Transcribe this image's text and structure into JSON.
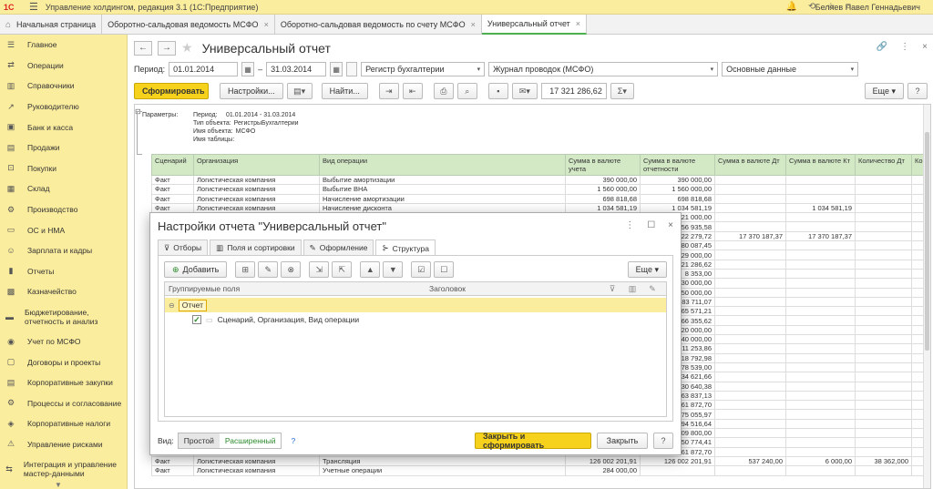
{
  "app": {
    "logo": "1С",
    "title": "Управление холдингом, редакция 3.1  (1С:Предприятие)",
    "user": "Беляев Павел Геннадьевич"
  },
  "tabs": [
    {
      "label": "Начальная страница"
    },
    {
      "label": "Оборотно-сальдовая ведомость МСФО"
    },
    {
      "label": "Оборотно-сальдовая ведомость по счету МСФО"
    },
    {
      "label": "Универсальный отчет"
    }
  ],
  "sidebar": {
    "items": [
      {
        "label": "Главное",
        "icon": "☰"
      },
      {
        "label": "Операции",
        "icon": "⇄"
      },
      {
        "label": "Справочники",
        "icon": "▥"
      },
      {
        "label": "Руководителю",
        "icon": "↗"
      },
      {
        "label": "Банк и касса",
        "icon": "▣"
      },
      {
        "label": "Продажи",
        "icon": "▤"
      },
      {
        "label": "Покупки",
        "icon": "⊡"
      },
      {
        "label": "Склад",
        "icon": "▦"
      },
      {
        "label": "Производство",
        "icon": "⚙"
      },
      {
        "label": "ОС и НМА",
        "icon": "▭"
      },
      {
        "label": "Зарплата и кадры",
        "icon": "☺"
      },
      {
        "label": "Отчеты",
        "icon": "▮"
      },
      {
        "label": "Казначейство",
        "icon": "▩"
      },
      {
        "label": "Бюджетирование, отчетность и анализ",
        "icon": "▬"
      },
      {
        "label": "Учет по МСФО",
        "icon": "◉"
      },
      {
        "label": "Договоры и проекты",
        "icon": "▢"
      },
      {
        "label": "Корпоративные закупки",
        "icon": "▤"
      },
      {
        "label": "Процессы и согласование",
        "icon": "⚙"
      },
      {
        "label": "Корпоративные налоги",
        "icon": "◈"
      },
      {
        "label": "Управление рисками",
        "icon": "⚠"
      },
      {
        "label": "Интеграция и управление мастер-данными",
        "icon": "⇆"
      }
    ]
  },
  "report": {
    "title": "Универсальный отчет",
    "period_label": "Период:",
    "date_from": "01.01.2014",
    "date_sep": "–",
    "date_to": "31.03.2014",
    "source": "Регистр бухгалтерии",
    "register": "Журнал проводок (МСФО)",
    "data_type": "Основные данные",
    "generate": "Сформировать",
    "settings": "Настройки...",
    "find": "Найти...",
    "sum_value": "17 321 286,62",
    "sigma": "Σ",
    "more": "Еще"
  },
  "params": {
    "heading": "Параметры:",
    "rows": [
      {
        "k": "Период:",
        "v": "01.01.2014 - 31.03.2014"
      },
      {
        "k": "Тип объекта:",
        "v": "РегистрыБухгалтерии"
      },
      {
        "k": "Имя объекта:",
        "v": "МСФО"
      },
      {
        "k": "Имя таблицы:",
        "v": ""
      }
    ]
  },
  "table": {
    "headers": [
      "Сценарий",
      "Организация",
      "Вид операции",
      "Сумма в валюте учета",
      "Сумма в валюте отчетности",
      "Сумма в валюте Дт",
      "Сумма в валюте Кт",
      "Количество Дт",
      "Ко"
    ],
    "rows": [
      [
        "Факт",
        "Логистическая компания",
        "Выбытие амортизации",
        "390 000,00",
        "390 000,00",
        "",
        "",
        "",
        ""
      ],
      [
        "Факт",
        "Логистическая компания",
        "Выбытие ВНА",
        "1 560 000,00",
        "1 560 000,00",
        "",
        "",
        "",
        ""
      ],
      [
        "Факт",
        "Логистическая компания",
        "Начисление амортизации",
        "698 818,68",
        "698 818,68",
        "",
        "",
        "",
        ""
      ],
      [
        "Факт",
        "Логистическая компания",
        "Начисление дисконта",
        "1 034 581,19",
        "1 034 581,19",
        "",
        "1 034 581,19",
        "",
        ""
      ],
      [
        "",
        "",
        "",
        "",
        "21 000,00",
        "",
        "",
        "",
        ""
      ],
      [
        "",
        "",
        "",
        "",
        "56 935,58",
        "",
        "",
        "",
        ""
      ],
      [
        "",
        "",
        "",
        "",
        "22 279,72",
        "17 370 187,37",
        "17 370 187,37",
        "",
        ""
      ],
      [
        "",
        "",
        "",
        "",
        "80 087,45",
        "",
        "",
        "",
        ""
      ],
      [
        "",
        "",
        "",
        "",
        "29 000,00",
        "",
        "",
        "",
        ""
      ],
      [
        "",
        "",
        "",
        "",
        "21 286,62",
        "",
        "",
        "",
        ""
      ],
      [
        "",
        "",
        "",
        "",
        "8 353,00",
        "",
        "",
        "",
        ""
      ],
      [
        "",
        "",
        "",
        "",
        "30 000,00",
        "",
        "",
        "",
        ""
      ],
      [
        "",
        "",
        "",
        "",
        "50 000,00",
        "",
        "",
        "",
        ""
      ],
      [
        "",
        "",
        "",
        "",
        "83 711,07",
        "",
        "",
        "",
        ""
      ],
      [
        "",
        "",
        "",
        "",
        "65 571,21",
        "",
        "",
        "",
        ""
      ],
      [
        "",
        "",
        "",
        "",
        "66 355,62",
        "",
        "",
        "",
        ""
      ],
      [
        "",
        "",
        "",
        "",
        "20 000,00",
        "",
        "",
        "",
        ""
      ],
      [
        "",
        "",
        "",
        "",
        "40 000,00",
        "",
        "",
        "",
        ""
      ],
      [
        "",
        "",
        "",
        "",
        "11 253,86",
        "",
        "",
        "",
        ""
      ],
      [
        "",
        "",
        "",
        "",
        "18 792,98",
        "",
        "",
        "",
        ""
      ],
      [
        "",
        "",
        "",
        "",
        "78 539,00",
        "",
        "",
        "",
        ""
      ],
      [
        "",
        "",
        "",
        "",
        "34 621,66",
        "",
        "",
        "",
        ""
      ],
      [
        "",
        "",
        "",
        "",
        "30 640,38",
        "",
        "",
        "",
        ""
      ],
      [
        "",
        "",
        "",
        "",
        "63 837,13",
        "",
        "",
        "",
        ""
      ],
      [
        "",
        "",
        "",
        "",
        "61 872,70",
        "",
        "",
        "",
        ""
      ],
      [
        "",
        "",
        "",
        "",
        "75 055,97",
        "",
        "",
        "",
        ""
      ],
      [
        "",
        "",
        "",
        "",
        "94 516,64",
        "",
        "",
        "",
        ""
      ],
      [
        "",
        "",
        "",
        "",
        "09 800,00",
        "",
        "",
        "",
        ""
      ],
      [
        "",
        "",
        "",
        "",
        "50 774,41",
        "",
        "",
        "",
        ""
      ],
      [
        "",
        "",
        "",
        "",
        "61 872,70",
        "",
        "",
        "",
        ""
      ],
      [
        "Факт",
        "Логистическая компания",
        "Трансляция",
        "126 002 201,91",
        "126 002 201,91",
        "537 240,00",
        "6 000,00",
        "38 362,000",
        ""
      ],
      [
        "Факт",
        "Логистическая компания",
        "Учетные операции",
        "284 000,00",
        "",
        "",
        "",
        "",
        ""
      ]
    ]
  },
  "dialog": {
    "title": "Настройки отчета \"Универсальный отчет\"",
    "tabs": [
      {
        "label": "Отборы",
        "icon": "⊽"
      },
      {
        "label": "Поля и сортировки",
        "icon": "▥"
      },
      {
        "label": "Оформление",
        "icon": "✎"
      },
      {
        "label": "Структура",
        "icon": "⊱"
      }
    ],
    "add": "Добавить",
    "more": "Еще",
    "col_fields": "Группируемые поля",
    "col_title": "Заголовок",
    "root": "Отчет",
    "child": "Сценарий, Организация, Вид операции",
    "view_label": "Вид:",
    "simple": "Простой",
    "extended": "Расширенный",
    "help": "?",
    "close_generate": "Закрыть и сформировать",
    "close": "Закрыть"
  }
}
